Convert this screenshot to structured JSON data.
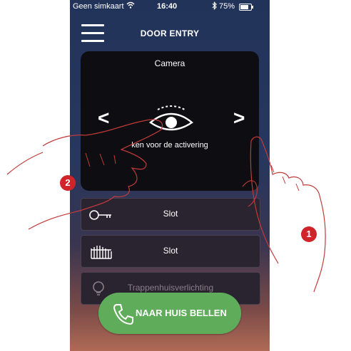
{
  "status_bar": {
    "carrier": "Geen simkaart",
    "time": "16:40",
    "battery": "75%",
    "battery_level_percent": 75
  },
  "header": {
    "title": "DOOR ENTRY"
  },
  "camera": {
    "title": "Camera",
    "activation_text": "ken voor de activering"
  },
  "actions": [
    {
      "label": "Slot",
      "icon": "key-icon"
    },
    {
      "label": "Slot",
      "icon": "gate-icon"
    },
    {
      "label": "Trappenhuisverlichting",
      "icon": "bulb-icon"
    }
  ],
  "call_button": {
    "label": "NAAR HUIS BELLEN",
    "icon": "phone-icon"
  },
  "callouts": [
    {
      "number": "2"
    },
    {
      "number": "1"
    }
  ],
  "colors": {
    "callout": "#d0232a",
    "call_button": "#5fad5a",
    "header_bg": "#22335a"
  }
}
